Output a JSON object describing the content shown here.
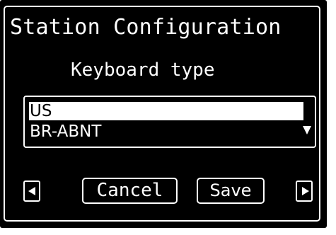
{
  "window": {
    "title": "Station Configuration"
  },
  "dialog": {
    "heading": "Keyboard type",
    "list": {
      "items": [
        "US",
        "BR-ABNT"
      ],
      "selected": "US"
    }
  },
  "buttons": {
    "cancel_label": "Cancel",
    "save_label": "Save"
  },
  "icons": {
    "nav_left": "left-arrow-icon",
    "nav_right": "right-arrow-icon",
    "scroll_down": "scroll-down-icon"
  },
  "colors": {
    "background": "#000000",
    "foreground": "#ffffff",
    "selection_background": "#ffffff",
    "selection_text": "#000000"
  }
}
